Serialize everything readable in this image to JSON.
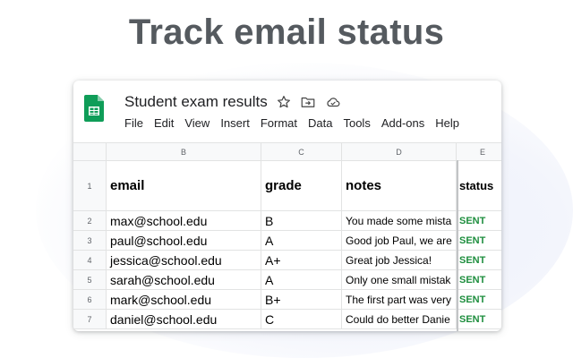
{
  "headline": "Track email status",
  "document": {
    "title": "Student exam results",
    "icons": [
      "sheets-logo-icon",
      "star-icon",
      "move-to-folder-icon",
      "cloud-saved-icon"
    ]
  },
  "menu": [
    "File",
    "Edit",
    "View",
    "Insert",
    "Format",
    "Data",
    "Tools",
    "Add-ons",
    "Help"
  ],
  "columns": [
    "B",
    "C",
    "D",
    "E"
  ],
  "header_row": {
    "row": "1",
    "email": "email",
    "grade": "grade",
    "notes": "notes",
    "status": "status"
  },
  "rows": [
    {
      "row": "2",
      "email": "max@school.edu",
      "grade": "B",
      "notes": "You made some mista",
      "status": "SENT"
    },
    {
      "row": "3",
      "email": "paul@school.edu",
      "grade": "A",
      "notes": "Good job Paul, we are",
      "status": "SENT"
    },
    {
      "row": "4",
      "email": "jessica@school.edu",
      "grade": "A+",
      "notes": "Great job Jessica!",
      "status": "SENT"
    },
    {
      "row": "5",
      "email": "sarah@school.edu",
      "grade": "A",
      "notes": "Only one small mistak",
      "status": "SENT"
    },
    {
      "row": "6",
      "email": "mark@school.edu",
      "grade": "B+",
      "notes": "The first part was very",
      "status": "SENT"
    },
    {
      "row": "7",
      "email": "daniel@school.edu",
      "grade": "C",
      "notes": "Could do better Danie",
      "status": "SENT"
    }
  ],
  "colors": {
    "sheets_green": "#0f9d58",
    "status_green": "#1e8e3e",
    "headline_gray": "#555a5f"
  }
}
